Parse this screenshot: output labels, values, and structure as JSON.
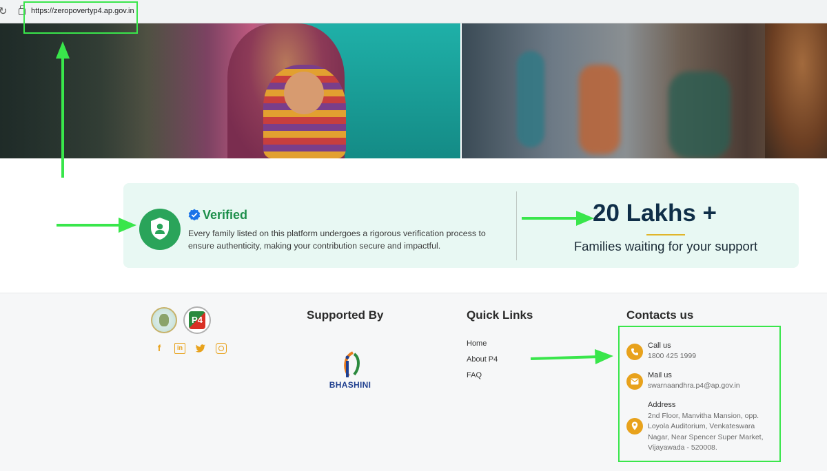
{
  "browser": {
    "url": "https://zeropovertyp4.ap.gov.in",
    "reload_icon": "reload-icon",
    "security_icon": "lock-icon"
  },
  "hero": {
    "left_image": "mother-and-child-photo",
    "right_image": "crowd-photo"
  },
  "verified": {
    "title": "Verified",
    "description": "Every family listed on this platform undergoes a rigorous verification process to ensure authenticity, making your contribution secure and impactful.",
    "icon": "shield-user-icon",
    "badge_icon": "verified-badge-icon"
  },
  "stats": {
    "count": "20 Lakhs +",
    "caption": "Families waiting for your support"
  },
  "footer": {
    "supported_title": "Supported By",
    "supporter_name": "BHASHINI",
    "quick_links_title": "Quick Links",
    "quick_links": [
      "Home",
      "About P4",
      "FAQ"
    ],
    "contacts_title": "Contacts us",
    "contacts": [
      {
        "label": "Call us",
        "value": "1800 425 1999",
        "icon": "phone-icon"
      },
      {
        "label": "Mail us",
        "value": "swarnaandhra.p4@ap.gov.in",
        "icon": "mail-icon"
      },
      {
        "label": "Address",
        "value_lines": [
          "2nd Floor, Manvitha Mansion, opp.",
          "Loyola Auditorium, Venkateswara",
          "Nagar, Near Spencer Super Market,",
          "Vijayawada - 520008."
        ],
        "icon": "location-pin-icon"
      }
    ],
    "social": [
      "facebook-icon",
      "linkedin-icon",
      "twitter-icon",
      "instagram-icon"
    ],
    "p4_logo_text": "P4"
  },
  "colors": {
    "accent_orange": "#e8a21c",
    "verified_green": "#2aa45a",
    "annotation_green": "#39e64b",
    "card_bg": "#e8f8f3",
    "heading_navy": "#0f2e48"
  }
}
